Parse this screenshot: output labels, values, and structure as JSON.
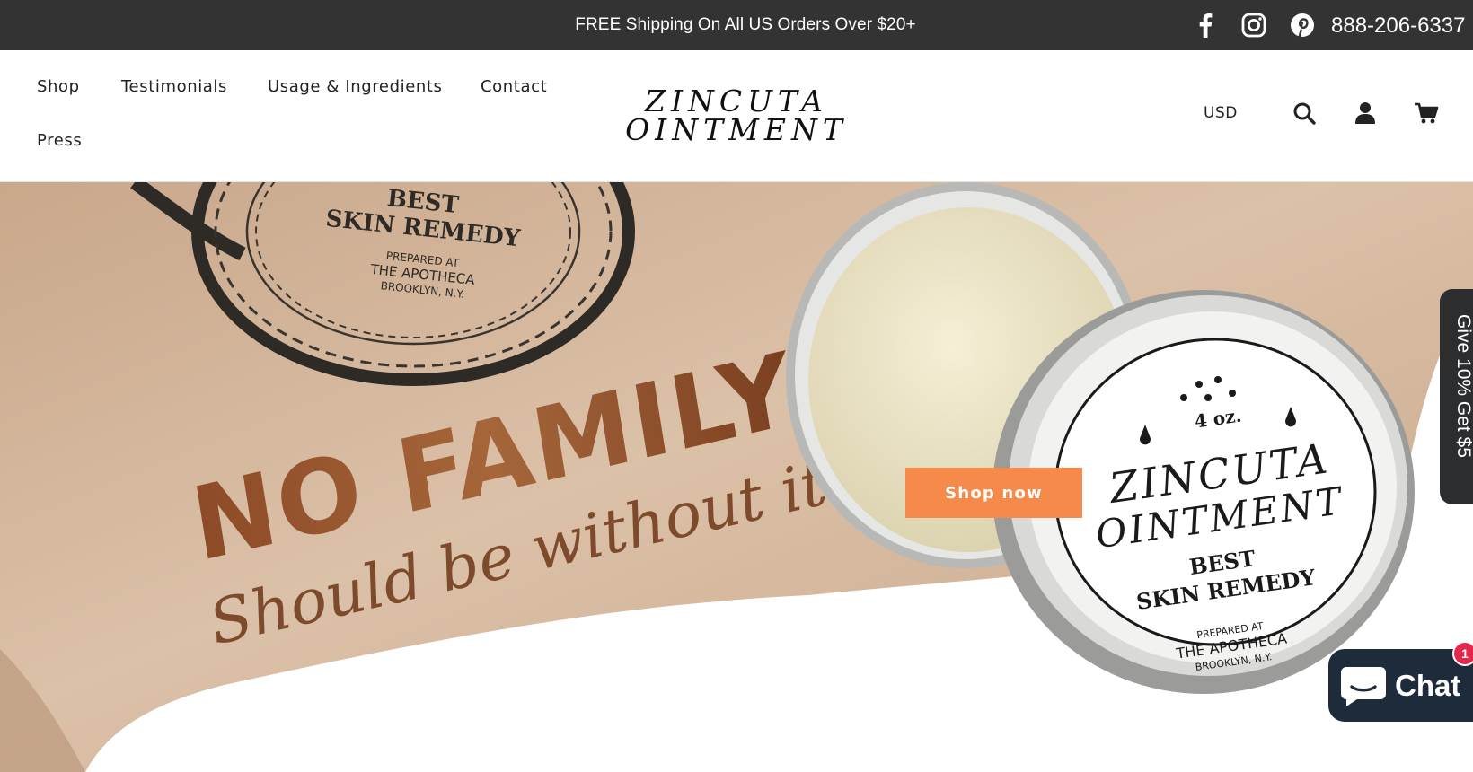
{
  "announcement": {
    "text": "FREE Shipping On All US Orders Over $20+"
  },
  "social": [
    {
      "name": "facebook",
      "icon": "facebook-icon"
    },
    {
      "name": "instagram",
      "icon": "instagram-icon"
    },
    {
      "name": "pinterest",
      "icon": "pinterest-icon"
    }
  ],
  "phone": "888-206-6337",
  "nav": {
    "items": [
      {
        "label": "Shop"
      },
      {
        "label": "Testimonials"
      },
      {
        "label": "Usage & Ingredients"
      },
      {
        "label": "Contact"
      },
      {
        "label": "Press"
      }
    ]
  },
  "logo": {
    "line1": "ZINCUTA",
    "line2": "OINTMENT"
  },
  "header": {
    "currency": "USD",
    "icons": [
      "search-icon",
      "account-icon",
      "cart-icon"
    ]
  },
  "hero": {
    "headline": "NO FAMILY",
    "subline": "Should be without it!",
    "cta_label": "Shop now",
    "tin_top": {
      "line1": "BEST",
      "line2": "SKIN REMEDY",
      "line3": "PREPARED AT",
      "line4": "THE APOTHECA",
      "line5": "BROOKLYN, N.Y."
    },
    "tin_lid": {
      "size": "4 oz.",
      "brand1": "ZINCUTA",
      "brand2": "OINTMENT",
      "line1": "BEST",
      "line2": "SKIN REMEDY",
      "line3": "PREPARED AT",
      "line4": "THE APOTHECA",
      "line5": "BROOKLYN, N.Y."
    }
  },
  "side_tab": {
    "label": "Give 10% Get $5"
  },
  "chat": {
    "label": "Chat",
    "badge_count": "1",
    "icon": "chat-bubble-icon"
  },
  "colors": {
    "topbar_bg": "#333333",
    "accent_orange": "#f58a4b",
    "chat_bg": "#1d2b3a",
    "badge_red": "#e3284c",
    "paper": "#d4b79c"
  }
}
